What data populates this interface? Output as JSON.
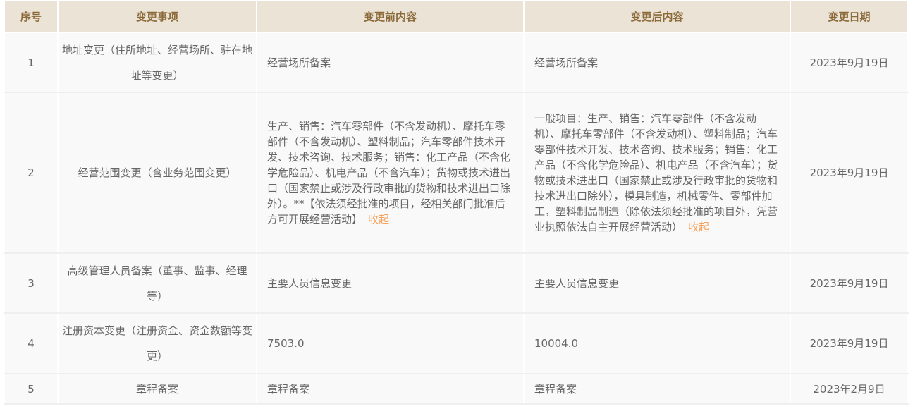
{
  "headers": [
    "序号",
    "变更事项",
    "变更前内容",
    "变更后内容",
    "变更日期"
  ],
  "rows": [
    {
      "no": "1",
      "item": "地址变更（住所地址、经营场所、驻在地址等变更）",
      "before": "经营场所备案",
      "after": "经营场所备案",
      "date": "2023年9月19日"
    },
    {
      "no": "2",
      "item": "经营范围变更（含业务范围变更）",
      "before": "生产、销售：汽车零部件（不含发动机）、摩托车零部件（不含发动机）、塑料制品；汽车零部件技术开发、技术咨询、技术服务；销售：化工产品（不含化学危险品）、机电产品（不含汽车）；货物或技术进出口（国家禁止或涉及行政审批的货物和技术进出口除外）。**【依法须经批准的项目，经相关部门批准后方可开展经营活动】",
      "after": "一般项目：生产、销售：汽车零部件（不含发动机）、摩托车零部件（不含发动机）、塑料制品；汽车零部件技术开发、技术咨询、技术服务；销售：化工产品（不含化学危险品）、机电产品（不含汽车）；货物或技术进出口（国家禁止或涉及行政审批的货物和技术进出口除外），模具制造，机械零件、零部件加工，塑料制品制造（除依法须经批准的项目外，凭营业执照依法自主开展经营活动）",
      "date": "2023年9月19日",
      "collapse_label": "收起"
    },
    {
      "no": "3",
      "item": "高级管理人员备案（董事、监事、经理等）",
      "before": "主要人员信息变更",
      "after": "主要人员信息变更",
      "date": "2023年9月19日"
    },
    {
      "no": "4",
      "item": "注册资本变更（注册资金、资金数额等变更）",
      "before": "7503.0",
      "after": "10004.0",
      "date": "2023年9月19日"
    },
    {
      "no": "5",
      "item": "章程备案",
      "before": "章程备案",
      "after": "章程备案",
      "date": "2023年2月9日"
    }
  ]
}
